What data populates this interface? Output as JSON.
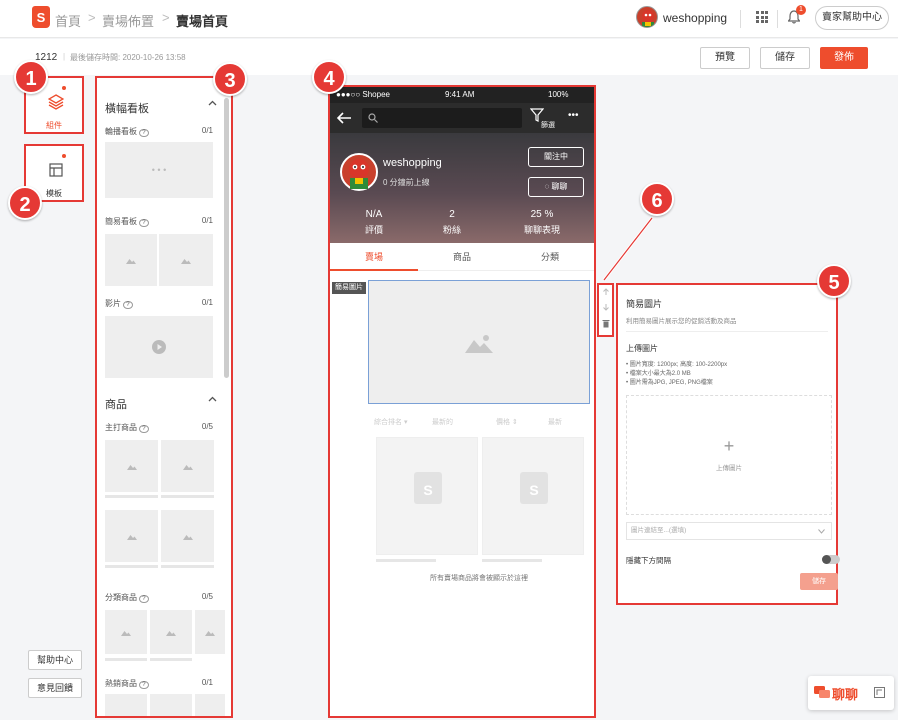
{
  "header": {
    "logo_letter": "S",
    "breadcrumb": [
      "首頁",
      "賣場佈置",
      "賣場首頁"
    ],
    "separator": ">",
    "username": "weshopping",
    "notif_count": "1",
    "help_center": "賣家幫助中心"
  },
  "subbar": {
    "page_name": "1212",
    "divider": "|",
    "last_saved": "最後儲存時間: 2020-10-26 13:58",
    "preview": "預覽",
    "save": "儲存",
    "publish": "發佈"
  },
  "leftnav": {
    "components_label": "組件",
    "templates_label": "模板",
    "help": "幫助中心",
    "feedback": "意見回饋"
  },
  "callouts": [
    "1",
    "2",
    "3",
    "4",
    "5",
    "6"
  ],
  "components_panel": {
    "section1_title": "橫幅看板",
    "items1": [
      {
        "name": "輪播看板",
        "count": "0/1"
      },
      {
        "name": "簡易看板",
        "count": "0/1"
      },
      {
        "name": "影片",
        "count": "0/1"
      }
    ],
    "carousel_dots": "• • •",
    "section2_title": "商品",
    "items2": [
      {
        "name": "主打商品",
        "count": "0/5"
      },
      {
        "name": "分類商品",
        "count": "0/5"
      },
      {
        "name": "熱銷商品",
        "count": "0/1"
      }
    ],
    "help_icon": "?"
  },
  "phone": {
    "carrier": "●●●○○ Shopee",
    "time": "9:41 AM",
    "battery": "100%",
    "filter_label": "篩選",
    "more": "•••",
    "shop_name": "weshopping",
    "shop_sub": "0 分鐘前上線",
    "follow": "關注中",
    "chat": "聊聊",
    "stats": [
      {
        "value": "N/A",
        "label": "評價"
      },
      {
        "value": "2",
        "label": "粉絲"
      },
      {
        "value": "25 %",
        "label": "聊聊表現"
      }
    ],
    "tabs": [
      "賣場",
      "商品",
      "分類"
    ],
    "banner_tag": "簡易圖片",
    "sort_options": [
      "綜合排名 ▾",
      "最新的",
      "價格 ⇕",
      "最新"
    ],
    "footer_note": "所有賣場商品將會被顯示於這裡"
  },
  "settings_panel": {
    "title": "簡易圖片",
    "desc": "利用簡易圖片展示您的促銷活動及商品",
    "upload_title": "上傳圖片",
    "specs": [
      "• 圖片寬度: 1200px; 高度: 100-2200px",
      "• 檔案大小最大為2.0 MB",
      "• 圖片需為JPG, JPEG, PNG檔案"
    ],
    "plus": "+",
    "upload_hint": "上傳圖片",
    "link_placeholder": "圖片連結至...(選填)",
    "hide_divider": "隱藏下方間隔",
    "save": "儲存"
  },
  "chat_widget": {
    "label": "聊聊"
  },
  "colors": {
    "brand": "#ee4d2d",
    "callout": "#e53935"
  }
}
